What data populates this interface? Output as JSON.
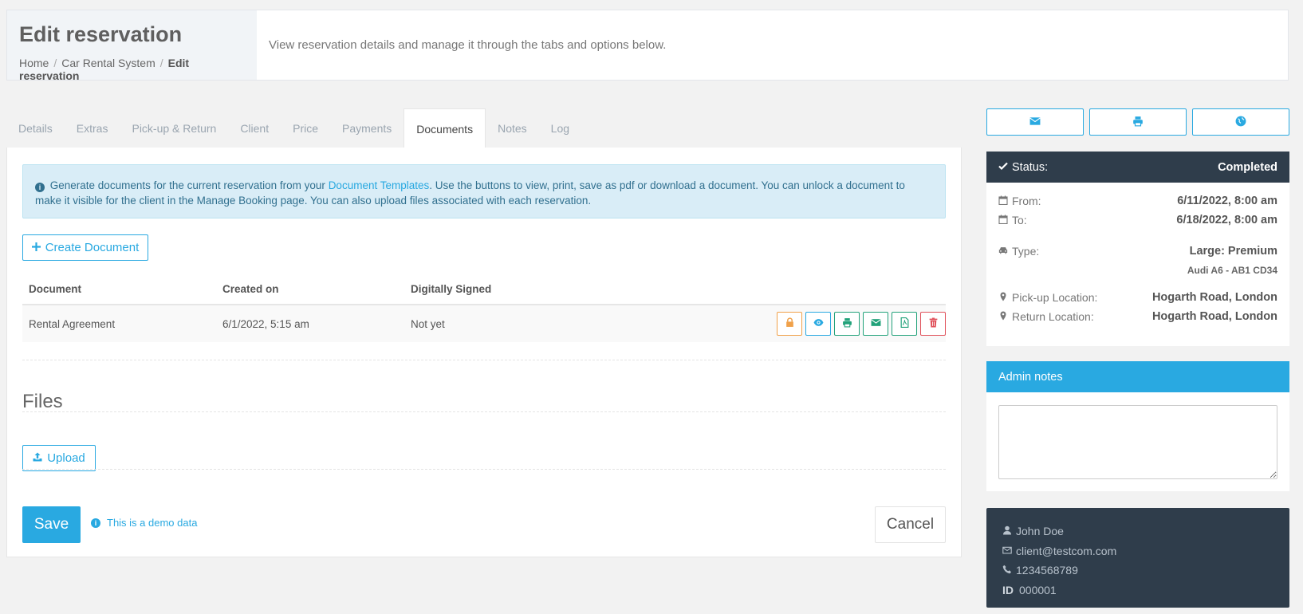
{
  "header": {
    "title": "Edit reservation",
    "breadcrumb": [
      "Home",
      "Car Rental System",
      "Edit reservation"
    ],
    "description": "View reservation details and manage it through the tabs and options below."
  },
  "tabs": [
    "Details",
    "Extras",
    "Pick-up & Return",
    "Client",
    "Price",
    "Payments",
    "Documents",
    "Notes",
    "Log"
  ],
  "active_tab": "Documents",
  "alert": {
    "text_before": "Generate documents for the current reservation from your ",
    "link": "Document Templates",
    "text_after": ". Use the buttons to view, print, save as pdf or download a document. You can unlock a document to make it visible for the client in the Manage Booking page. You can also upload files associated with each reservation."
  },
  "create_document_label": "Create Document",
  "documents_table": {
    "headers": [
      "Document",
      "Created on",
      "Digitally Signed"
    ],
    "rows": [
      {
        "document": "Rental Agreement",
        "created_on": "6/1/2022, 5:15 am",
        "signed": "Not yet"
      }
    ],
    "row_actions": [
      "lock-icon",
      "eye-icon",
      "print-icon",
      "envelope-icon",
      "pdf-icon",
      "trash-icon"
    ]
  },
  "files": {
    "title": "Files",
    "upload_label": "Upload"
  },
  "footer": {
    "save_label": "Save",
    "demo_note": "This is a demo data",
    "cancel_label": "Cancel"
  },
  "top_actions": [
    "envelope-icon",
    "print-icon",
    "globe-icon"
  ],
  "status": {
    "label": "Status:",
    "value": "Completed",
    "from_label": "From:",
    "from_value": "6/11/2022, 8:00 am",
    "to_label": "To:",
    "to_value": "6/18/2022, 8:00 am",
    "type_label": "Type:",
    "type_value": "Large: Premium",
    "vehicle": "Audi A6 - AB1 CD34",
    "pickup_label": "Pick-up Location:",
    "pickup_value": "Hogarth Road, London",
    "return_label": "Return Location:",
    "return_value": "Hogarth Road, London"
  },
  "admin_notes": {
    "title": "Admin notes",
    "value": ""
  },
  "client": {
    "name": "John Doe",
    "email": "client@testcom.com",
    "phone": "1234568789",
    "id_label": "ID",
    "id_value": "000001"
  },
  "colors": {
    "accent": "#29a9e1",
    "dark_panel": "#2f3d4b",
    "alert_bg": "#d9edf7",
    "lock_orange": "#f0a14a",
    "action_green": "#22a27a",
    "delete_red": "#e0505a"
  }
}
